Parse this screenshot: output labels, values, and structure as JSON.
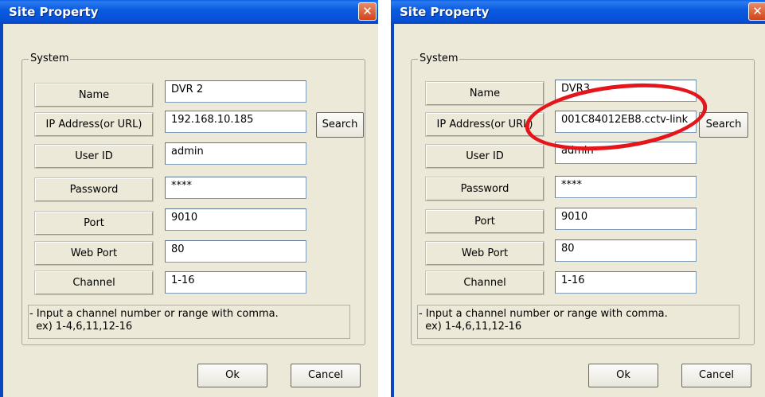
{
  "dialog": {
    "title": "Site Property",
    "close_glyph": "✕",
    "group_label": "System",
    "labels": {
      "name": "Name",
      "ip": "IP Address(or URL)",
      "user_id": "User ID",
      "password": "Password",
      "port": "Port",
      "web_port": "Web Port",
      "channel": "Channel"
    },
    "buttons": {
      "search": "Search",
      "ok": "Ok",
      "cancel": "Cancel"
    },
    "note_line1": "- Input a channel number or range with comma.",
    "note_line2": "  ex) 1-4,6,11,12-16"
  },
  "left": {
    "name": "DVR 2",
    "ip": "192.168.10.185",
    "user_id": "admin",
    "password": "****",
    "port": "9010",
    "web_port": "80",
    "channel": "1-16"
  },
  "right": {
    "name": "DVR3",
    "ip": "001C84012EB8.cctv-link",
    "user_id": "admin",
    "password": "****",
    "port": "9010",
    "web_port": "80",
    "channel": "1-16"
  },
  "colors": {
    "titlebar": "#0a5be0",
    "highlight_ellipse": "#e5151c",
    "dialog_bg": "#ece9d8"
  },
  "icons": {
    "close": "close-icon"
  }
}
